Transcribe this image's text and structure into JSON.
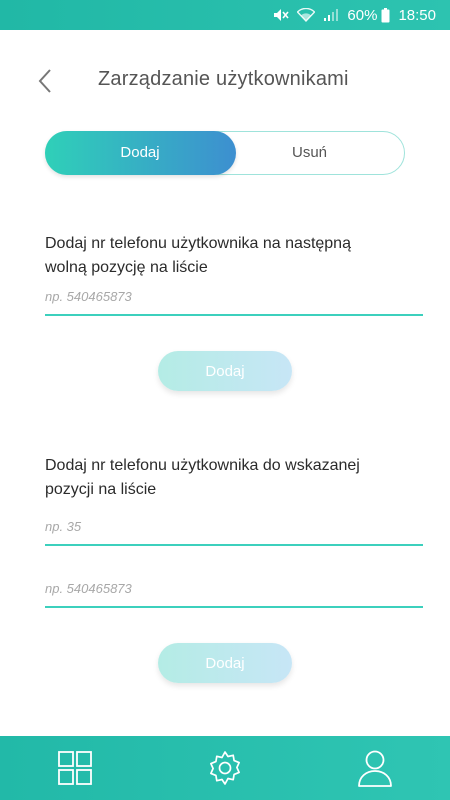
{
  "status_bar": {
    "battery": "60%",
    "time": "18:50",
    "icons": [
      "mute-icon",
      "wifi-icon",
      "signal-icon",
      "battery-icon"
    ]
  },
  "header": {
    "title": "Zarządzanie użytkownikami",
    "back_icon": "chevron-left-icon"
  },
  "tabs": {
    "add": "Dodaj",
    "remove": "Usuń",
    "active": "add"
  },
  "section_next": {
    "label": "Dodaj nr telefonu użytkownika na następną wolną pozycję na liście",
    "phone_placeholder": "np. 540465873",
    "button": "Dodaj"
  },
  "section_position": {
    "label": "Dodaj nr telefonu użytkownika do wskazanej pozycji na liście",
    "position_placeholder": "np. 35",
    "phone_placeholder": "np. 540465873",
    "button": "Dodaj"
  },
  "bottom_nav": {
    "items": [
      "grid-icon",
      "settings-icon",
      "user-icon"
    ]
  },
  "colors": {
    "accent": "#2dc3b0",
    "tab_gradient_start": "#2fd0b8",
    "tab_gradient_end": "#3d8fd0",
    "input_underline": "#3cd0bd",
    "button_disabled": "#bde9ec"
  }
}
